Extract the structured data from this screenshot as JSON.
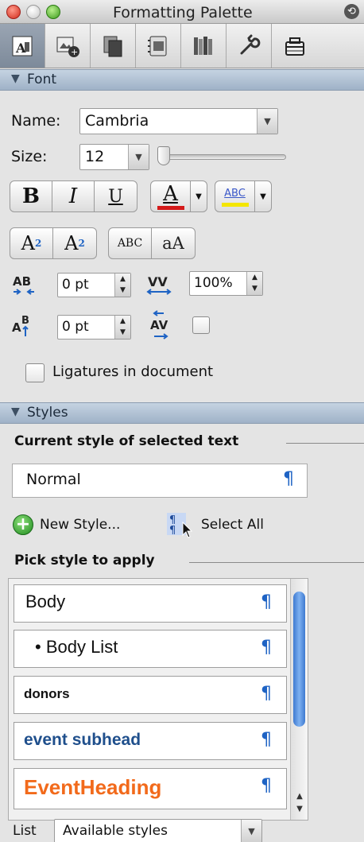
{
  "window": {
    "title": "Formatting Palette"
  },
  "toolbar": {
    "tabs": [
      {
        "icon": "text-format-icon",
        "active": true
      },
      {
        "icon": "add-objects-icon",
        "active": false
      },
      {
        "icon": "copy-pages-icon",
        "active": false
      },
      {
        "icon": "scrapbook-icon",
        "active": false
      },
      {
        "icon": "reference-tools-icon",
        "active": false
      },
      {
        "icon": "toolbox-wrench-icon",
        "active": false
      },
      {
        "icon": "projects-icon",
        "active": false
      }
    ]
  },
  "font": {
    "header": "Font",
    "name_label": "Name:",
    "name_value": "Cambria",
    "size_label": "Size:",
    "size_value": "12",
    "bold": "B",
    "italic": "I",
    "underline": "U",
    "font_color_letter": "A",
    "highlight_letters": "ABC",
    "superscript": "A",
    "superscript_mark": "2",
    "subscript": "A",
    "subscript_mark": "2",
    "small_caps": "ABC",
    "change_case": "aA",
    "spacing_value": "0 pt",
    "scale_value": "100%",
    "position_value": "0 pt",
    "ligatures_label": "Ligatures in document"
  },
  "styles": {
    "header": "Styles",
    "current_label": "Current style of selected text",
    "current_value": "Normal",
    "new_style": "New Style...",
    "select_all": "Select All",
    "pick_label": "Pick style to apply",
    "items": [
      {
        "name": "Body"
      },
      {
        "name": "• Body List"
      },
      {
        "name": "donors"
      },
      {
        "name": "event subhead"
      },
      {
        "name": "EventHeading"
      }
    ],
    "list_label": "List",
    "list_value": "Available styles",
    "pilcrow": "¶"
  },
  "colors": {
    "accent": "#1e63c4",
    "event_subhead": "#1f4f8c",
    "event_heading": "#f26a1b",
    "font_color_bar": "#d41a1a",
    "highlight_bar": "#f4e600"
  }
}
